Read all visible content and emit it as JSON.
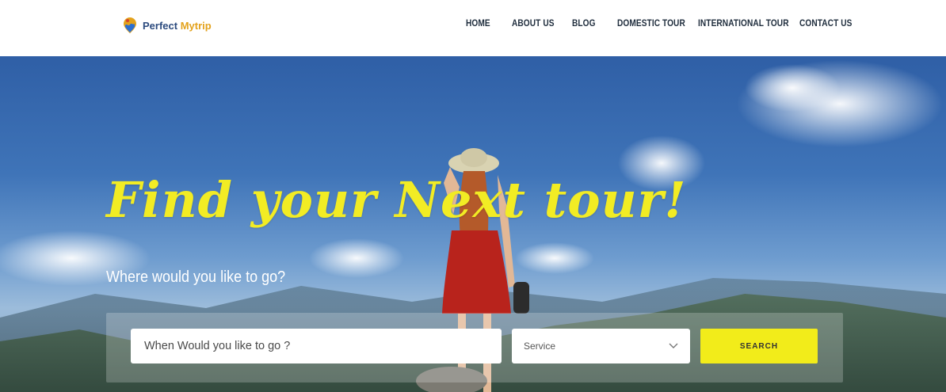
{
  "brand": {
    "name_part1": "Perfect",
    "name_part2": "Mytrip",
    "icon": "map-pin-logo-icon",
    "colors": {
      "primary": "#2b4a7e",
      "accent": "#e3a21c"
    }
  },
  "nav": {
    "items": [
      {
        "label": "HOME"
      },
      {
        "label": "ABOUT US"
      },
      {
        "label": "BLOG"
      },
      {
        "label": "DOMESTIC TOUR"
      },
      {
        "label": "INTERNATIONAL TOUR"
      },
      {
        "label": "CONTACT US"
      }
    ]
  },
  "hero": {
    "headline": "Find your Next tour!",
    "subheadline": "Where would you like to go?",
    "headline_color": "#f2ec24"
  },
  "search": {
    "placeholder": "When Would you like to go ?",
    "service_label": "Service",
    "service_icon": "chevron-down-icon",
    "button_label": "SEARCH",
    "button_color": "#f2ec1a"
  }
}
